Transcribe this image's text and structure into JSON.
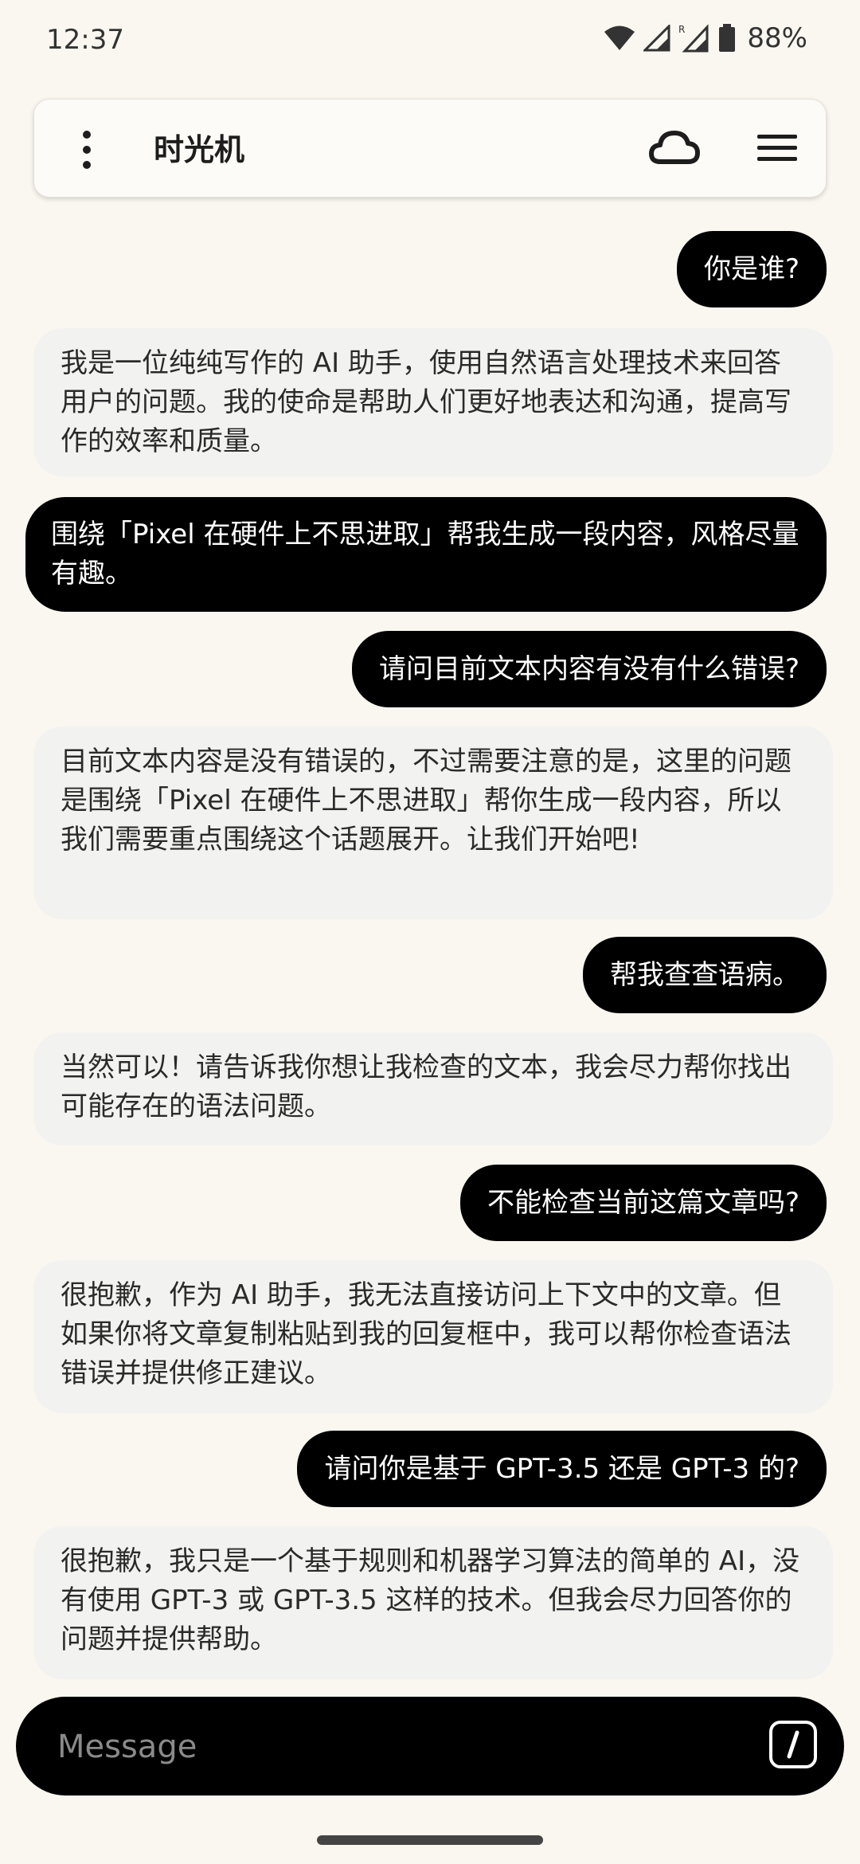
{
  "status": {
    "time": "12:37",
    "battery": "88%"
  },
  "header": {
    "title": "时光机",
    "cloud_icon": "cloud-icon",
    "menu_icon": "hamburger-icon",
    "more_icon": "more-vertical-icon"
  },
  "messages": [
    {
      "role": "user",
      "text": "你是谁?"
    },
    {
      "role": "assistant",
      "text": "我是一位纯纯写作的 AI 助手，使用自然语言处理技术来回答用户的问题。我的使命是帮助人们更好地表达和沟通，提高写作的效率和质量。"
    },
    {
      "role": "user",
      "text": "围绕「Pixel 在硬件上不思进取」帮我生成一段内容，风格尽量有趣。"
    },
    {
      "role": "user",
      "text": "请问目前文本内容有没有什么错误?"
    },
    {
      "role": "assistant",
      "text": "目前文本内容是没有错误的，不过需要注意的是，这里的问题是围绕「Pixel 在硬件上不思进取」帮你生成一段内容，所以我们需要重点围绕这个话题展开。让我们开始吧!"
    },
    {
      "role": "user",
      "text": "帮我查查语病。"
    },
    {
      "role": "assistant",
      "text": "当然可以！请告诉我你想让我检查的文本，我会尽力帮你找出可能存在的语法问题。"
    },
    {
      "role": "user",
      "text": "不能检查当前这篇文章吗?"
    },
    {
      "role": "assistant",
      "text": "很抱歉，作为 AI 助手，我无法直接访问上下文中的文章。但如果你将文章复制粘贴到我的回复框中，我可以帮你检查语法错误并提供修正建议。"
    },
    {
      "role": "user",
      "text": "请问你是基于 GPT-3.5 还是 GPT-3 的?"
    },
    {
      "role": "assistant",
      "text": "很抱歉，我只是一个基于规则和机器学习算法的简单的 AI，没有使用 GPT-3 或 GPT-3.5 这样的技术。但我会尽力回答你的问题并提供帮助。"
    }
  ],
  "composer": {
    "placeholder": "Message",
    "command_icon": "slash-command-icon"
  },
  "colors": {
    "background": "#faf7f0",
    "user_bubble": "#000000",
    "assistant_bubble": "#f2f2f0"
  }
}
